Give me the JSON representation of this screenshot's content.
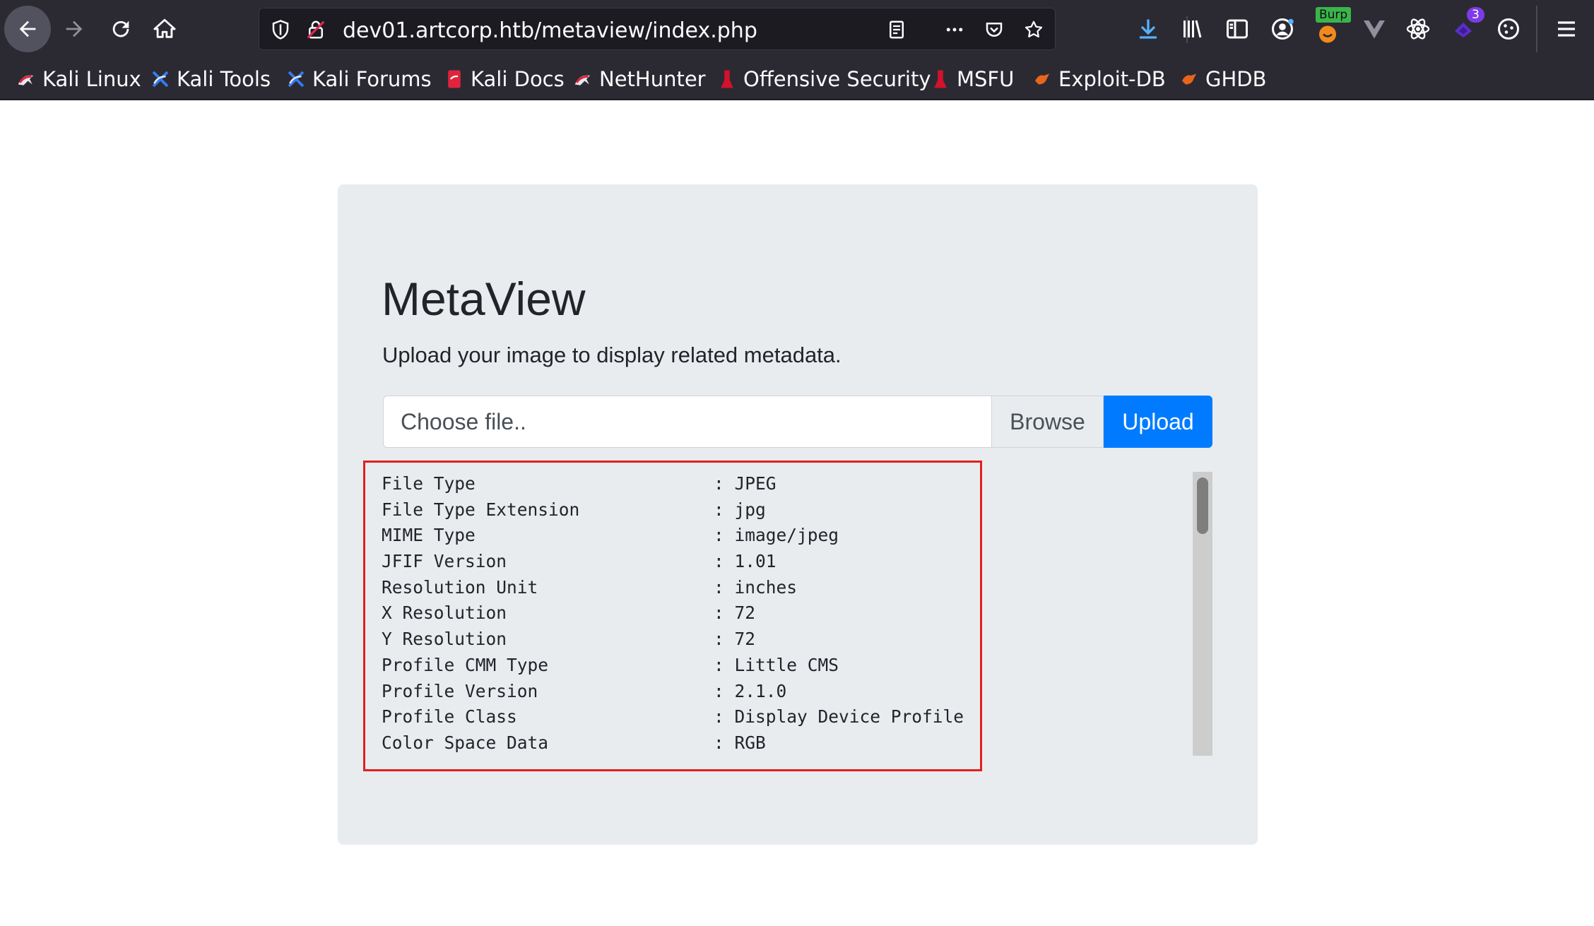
{
  "browser": {
    "url": "dev01.artcorp.htb/metaview/index.php",
    "burp_badge": "Burp",
    "extension_count": "3",
    "bookmarks": [
      {
        "label": "Kali Linux",
        "icon": "kali-icon"
      },
      {
        "label": "Kali Tools",
        "icon": "kali-tools-icon"
      },
      {
        "label": "Kali Forums",
        "icon": "kali-forums-icon"
      },
      {
        "label": "Kali Docs",
        "icon": "kali-docs-icon"
      },
      {
        "label": "NetHunter",
        "icon": "nethunter-icon"
      },
      {
        "label": "Offensive Security",
        "icon": "offsec-icon"
      },
      {
        "label": "MSFU",
        "icon": "msfu-icon"
      },
      {
        "label": "Exploit-DB",
        "icon": "exploit-db-icon"
      },
      {
        "label": "GHDB",
        "icon": "ghdb-icon"
      }
    ]
  },
  "page": {
    "title": "MetaView",
    "lead": "Upload your image to display related metadata.",
    "file_placeholder": "Choose file..",
    "browse_label": "Browse",
    "upload_label": "Upload",
    "metadata": [
      {
        "key": "File Type",
        "value": ": JPEG"
      },
      {
        "key": "File Type Extension",
        "value": ": jpg"
      },
      {
        "key": "MIME Type",
        "value": ": image/jpeg"
      },
      {
        "key": "JFIF Version",
        "value": ": 1.01"
      },
      {
        "key": "Resolution Unit",
        "value": ": inches"
      },
      {
        "key": "X Resolution",
        "value": ": 72"
      },
      {
        "key": "Y Resolution",
        "value": ": 72"
      },
      {
        "key": "Profile CMM Type",
        "value": ": Little CMS"
      },
      {
        "key": "Profile Version",
        "value": ": 2.1.0"
      },
      {
        "key": "Profile Class",
        "value": ": Display Device Profile"
      },
      {
        "key": "Color Space Data",
        "value": ": RGB"
      }
    ]
  },
  "colors": {
    "chrome": "#2b2a33",
    "accent": "#007bff",
    "highlight_border": "#e02020"
  }
}
